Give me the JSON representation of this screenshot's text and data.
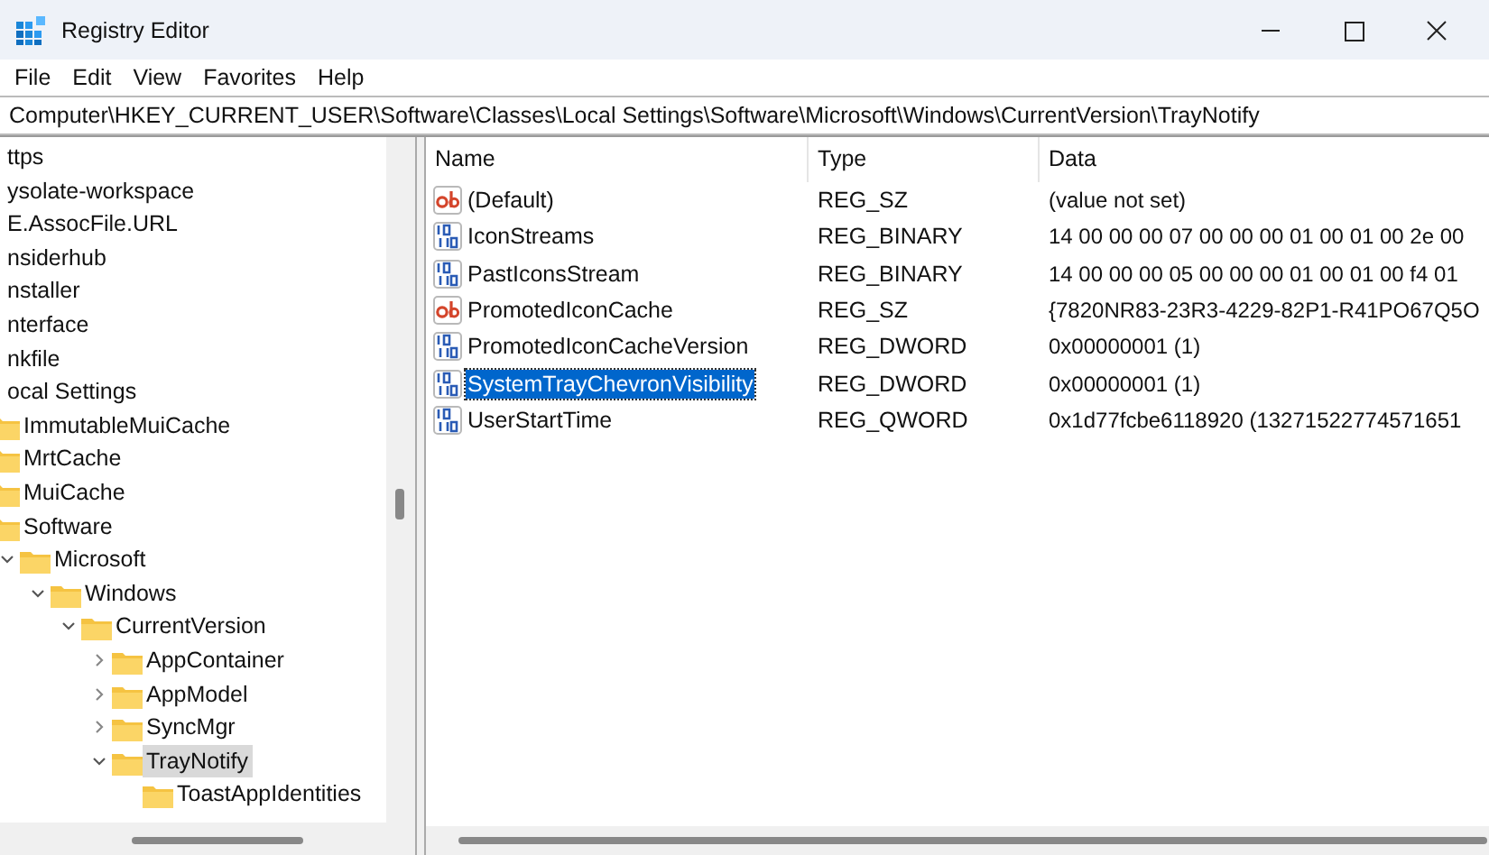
{
  "window": {
    "title": "Registry Editor"
  },
  "menu": [
    "File",
    "Edit",
    "View",
    "Favorites",
    "Help"
  ],
  "address": "Computer\\HKEY_CURRENT_USER\\Software\\Classes\\Local Settings\\Software\\Microsoft\\Windows\\CurrentVersion\\TrayNotify",
  "tree": [
    {
      "label": "ttps",
      "selected": false
    },
    {
      "label": "ysolate-workspace",
      "selected": false
    },
    {
      "label": "E.AssocFile.URL",
      "selected": false
    },
    {
      "label": "nsiderhub",
      "selected": false
    },
    {
      "label": "nstaller",
      "selected": false
    },
    {
      "label": "nterface",
      "selected": false
    },
    {
      "label": "nkfile",
      "selected": false
    },
    {
      "label": "ocal Settings",
      "selected": false,
      "children": [
        {
          "label": "ImmutableMuiCache",
          "selected": false
        },
        {
          "label": "MrtCache",
          "selected": false
        },
        {
          "label": "MuiCache",
          "selected": false
        },
        {
          "label": "Software",
          "selected": false,
          "children": [
            {
              "label": "Microsoft",
              "selected": false,
              "expanded": true,
              "children": [
                {
                  "label": "Windows",
                  "selected": false,
                  "expanded": true,
                  "children": [
                    {
                      "label": "CurrentVersion",
                      "selected": false,
                      "expanded": true,
                      "children": [
                        {
                          "label": "AppContainer",
                          "selected": false,
                          "expanded": false
                        },
                        {
                          "label": "AppModel",
                          "selected": false,
                          "expanded": false
                        },
                        {
                          "label": "SyncMgr",
                          "selected": false,
                          "expanded": false
                        },
                        {
                          "label": "TrayNotify",
                          "selected": true,
                          "expanded": true,
                          "children": [
                            {
                              "label": "ToastAppIdentities",
                              "selected": false
                            }
                          ]
                        }
                      ]
                    }
                  ]
                }
              ]
            }
          ]
        }
      ]
    }
  ],
  "table": {
    "columns": [
      "Name",
      "Type",
      "Data"
    ],
    "rows": [
      {
        "kind": "string",
        "name": "(Default)",
        "type": "REG_SZ",
        "data": "(value not set)",
        "selected": false
      },
      {
        "kind": "binary",
        "name": "IconStreams",
        "type": "REG_BINARY",
        "data": "14 00 00 00 07 00 00 00 01 00 01 00 2e 00",
        "selected": false
      },
      {
        "kind": "binary",
        "name": "PastIconsStream",
        "type": "REG_BINARY",
        "data": "14 00 00 00 05 00 00 00 01 00 01 00 f4 01",
        "selected": false
      },
      {
        "kind": "string",
        "name": "PromotedIconCache",
        "type": "REG_SZ",
        "data": "{7820NR83-23R3-4229-82P1-R41PO67Q5O",
        "selected": false
      },
      {
        "kind": "binary",
        "name": "PromotedIconCacheVersion",
        "type": "REG_DWORD",
        "data": "0x00000001 (1)",
        "selected": false
      },
      {
        "kind": "binary",
        "name": "SystemTrayChevronVisibility",
        "type": "REG_DWORD",
        "data": "0x00000001 (1)",
        "selected": true
      },
      {
        "kind": "binary",
        "name": "UserStartTime",
        "type": "REG_QWORD",
        "data": "0x1d77fcbe6118920 (13271522774571651",
        "selected": false
      }
    ]
  }
}
